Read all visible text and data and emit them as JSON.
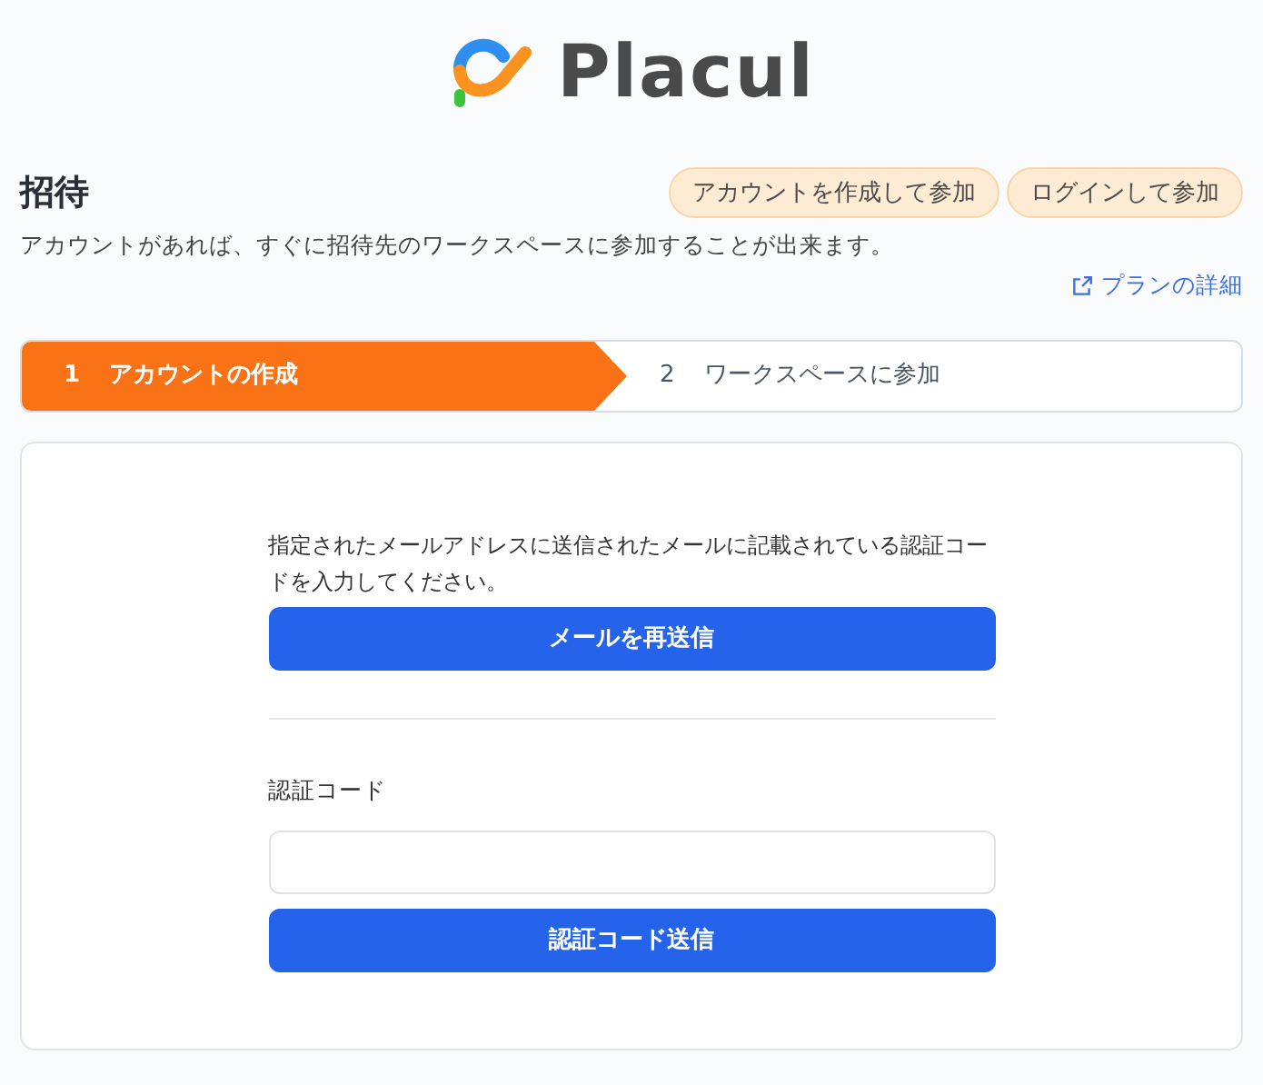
{
  "logo": {
    "text": "Placul"
  },
  "header": {
    "title": "招待",
    "buttons": [
      "アカウントを作成して参加",
      "ログインして参加"
    ]
  },
  "description": "アカウントがあれば、すぐに招待先のワークスペースに参加することが出来ます。",
  "plan_link": "プランの詳細",
  "steps": [
    {
      "number": "1",
      "label": "アカウントの作成",
      "selected": true
    },
    {
      "number": "2",
      "label": "ワークスペースに参加",
      "selected": false
    }
  ],
  "card": {
    "instruction": "指定されたメールアドレスに送信されたメールに記載されている認証コードを入力してください。",
    "resend_button": "メールを再送信",
    "code_label": "認証コード",
    "submit_button": "認証コード送信"
  }
}
